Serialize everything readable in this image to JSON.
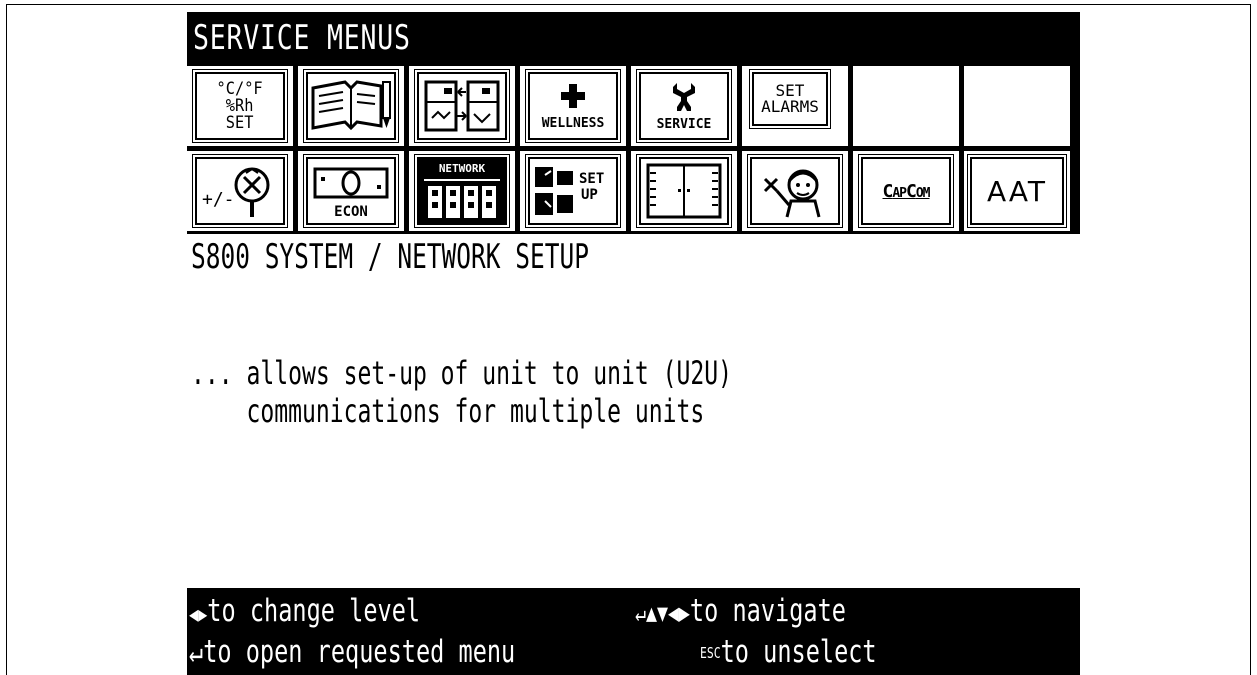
{
  "title": "SERVICE MENUS",
  "row1": [
    {
      "name": "temp-humidity-set-icon",
      "text": "°C/°F %Rh SET"
    },
    {
      "name": "manual-book-icon",
      "text": ""
    },
    {
      "name": "transfer-icon",
      "text": ""
    },
    {
      "name": "wellness-icon",
      "text": "WELLNESS"
    },
    {
      "name": "service-icon",
      "text": "SERVICE"
    },
    {
      "name": "set-alarms-icon",
      "text": "SET ALARMS"
    },
    {
      "name": "empty-tile-1",
      "text": ""
    },
    {
      "name": "empty-tile-2",
      "text": ""
    }
  ],
  "row2": [
    {
      "name": "adjust-icon",
      "text": "+/-"
    },
    {
      "name": "econ-icon",
      "text": "ECON"
    },
    {
      "name": "network-icon",
      "text": "NETWORK"
    },
    {
      "name": "setup-icon",
      "text": "SET UP"
    },
    {
      "name": "panel-icon",
      "text": ""
    },
    {
      "name": "technician-icon",
      "text": ""
    },
    {
      "name": "capcom-icon",
      "text": "CAPCOM"
    },
    {
      "name": "aat-icon",
      "text": "AAT"
    }
  ],
  "content": {
    "heading": "S800 SYSTEM / NETWORK SETUP",
    "line1": "... allows set-up of unit to unit (U2U)",
    "line2": "    communications for multiple units"
  },
  "footer": {
    "hint1_symbol": "◀▶",
    "hint1": "to change level",
    "hint2_symbol": "↵",
    "hint2": "to open requested menu",
    "hint3_symbol": "↵▲▼◀▶",
    "hint3": "to navigate",
    "hint4_symbol": "ESC",
    "hint4": "to unselect"
  },
  "colors": {
    "background": "#000000",
    "foreground": "#ffffff"
  }
}
